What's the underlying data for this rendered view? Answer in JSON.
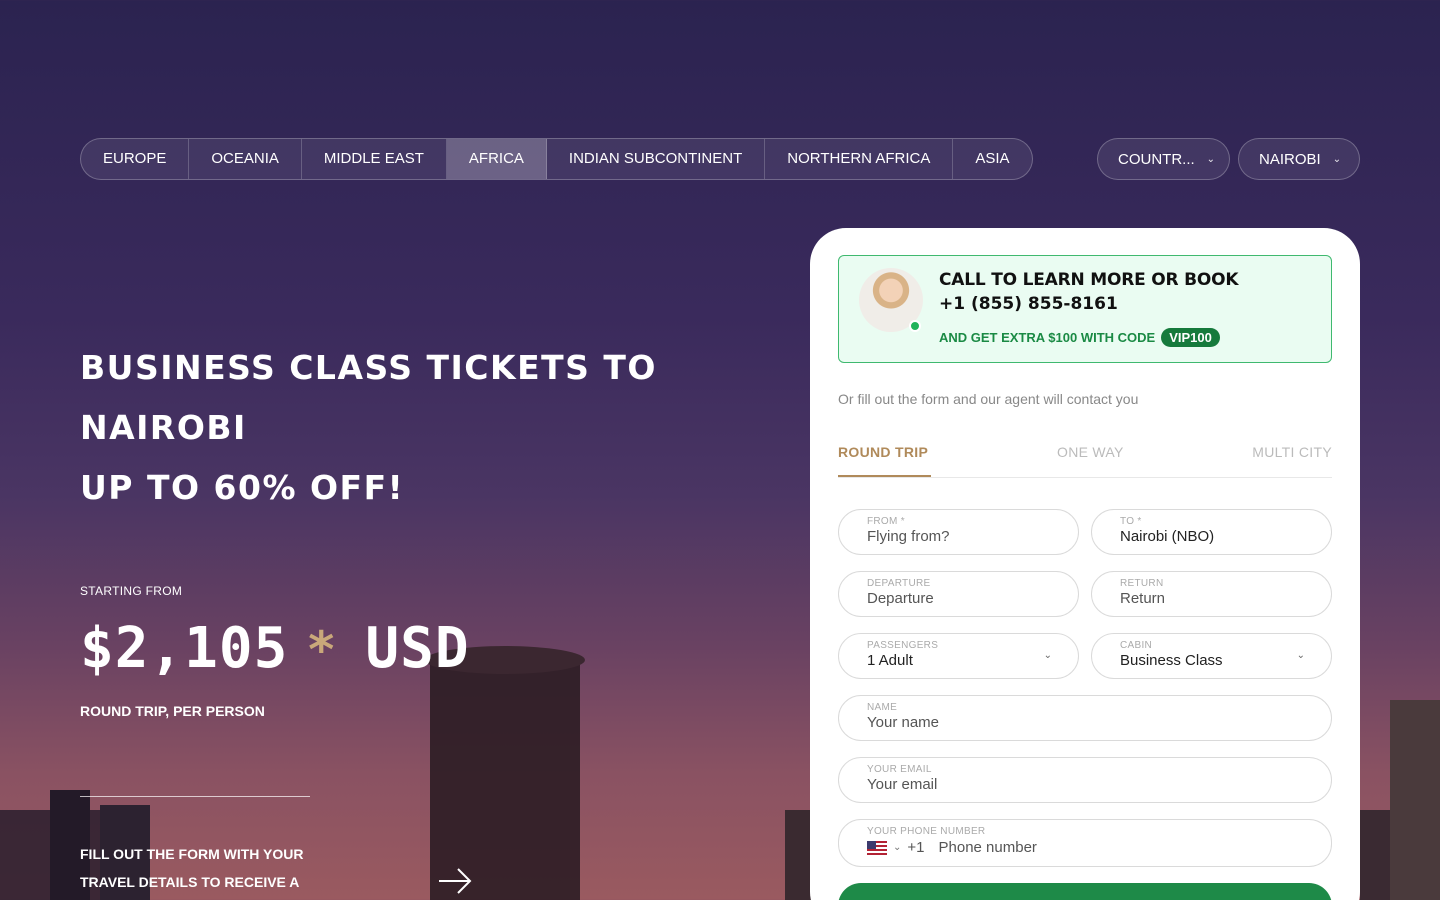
{
  "regions": [
    "EUROPE",
    "OCEANIA",
    "MIDDLE EAST",
    "AFRICA",
    "INDIAN SUBCONTINENT",
    "NORTHERN AFRICA",
    "ASIA"
  ],
  "active_region": "AFRICA",
  "country_dropdown": "COUNTR...",
  "city_dropdown": "NAIROBI",
  "hero": {
    "title_line1": "BUSINESS CLASS TICKETS TO",
    "title_line2": "NAIROBI",
    "title_line3": "UP TO 60% OFF!",
    "starting_from": "STARTING FROM",
    "price": "$2,105",
    "price_star": "*",
    "currency": "USD",
    "round_trip_note": "ROUND TRIP, PER PERSON",
    "fill_note": "FILL OUT THE FORM WITH YOUR TRAVEL DETAILS TO RECEIVE A"
  },
  "call": {
    "title": "CALL TO LEARN MORE OR BOOK",
    "phone": "+1 (855) 855-8161",
    "extra": "AND GET EXTRA $100 WITH CODE",
    "code": "VIP100"
  },
  "form": {
    "intro": "Or fill out the form and our agent will contact you",
    "trip_tabs": [
      "ROUND TRIP",
      "ONE WAY",
      "MULTI CITY"
    ],
    "from_label": "FROM *",
    "from_placeholder": "Flying from?",
    "to_label": "TO *",
    "to_value": "Nairobi (NBO)",
    "departure_label": "DEPARTURE",
    "departure_placeholder": "Departure",
    "return_label": "RETURN",
    "return_placeholder": "Return",
    "passengers_label": "PASSENGERS",
    "passengers_value": "1 Adult",
    "cabin_label": "CABIN",
    "cabin_value": "Business Class",
    "name_label": "NAME",
    "name_placeholder": "Your name",
    "email_label": "YOUR EMAIL",
    "email_placeholder": "Your email",
    "phone_label": "YOUR PHONE NUMBER",
    "phone_code": "+1",
    "phone_placeholder": "Phone number"
  },
  "colors": {
    "accent_gold": "#b08a5a",
    "green": "#1e8a48"
  },
  "icons": [
    "chevron-down-icon",
    "arrow-right-icon",
    "us-flag-icon"
  ]
}
